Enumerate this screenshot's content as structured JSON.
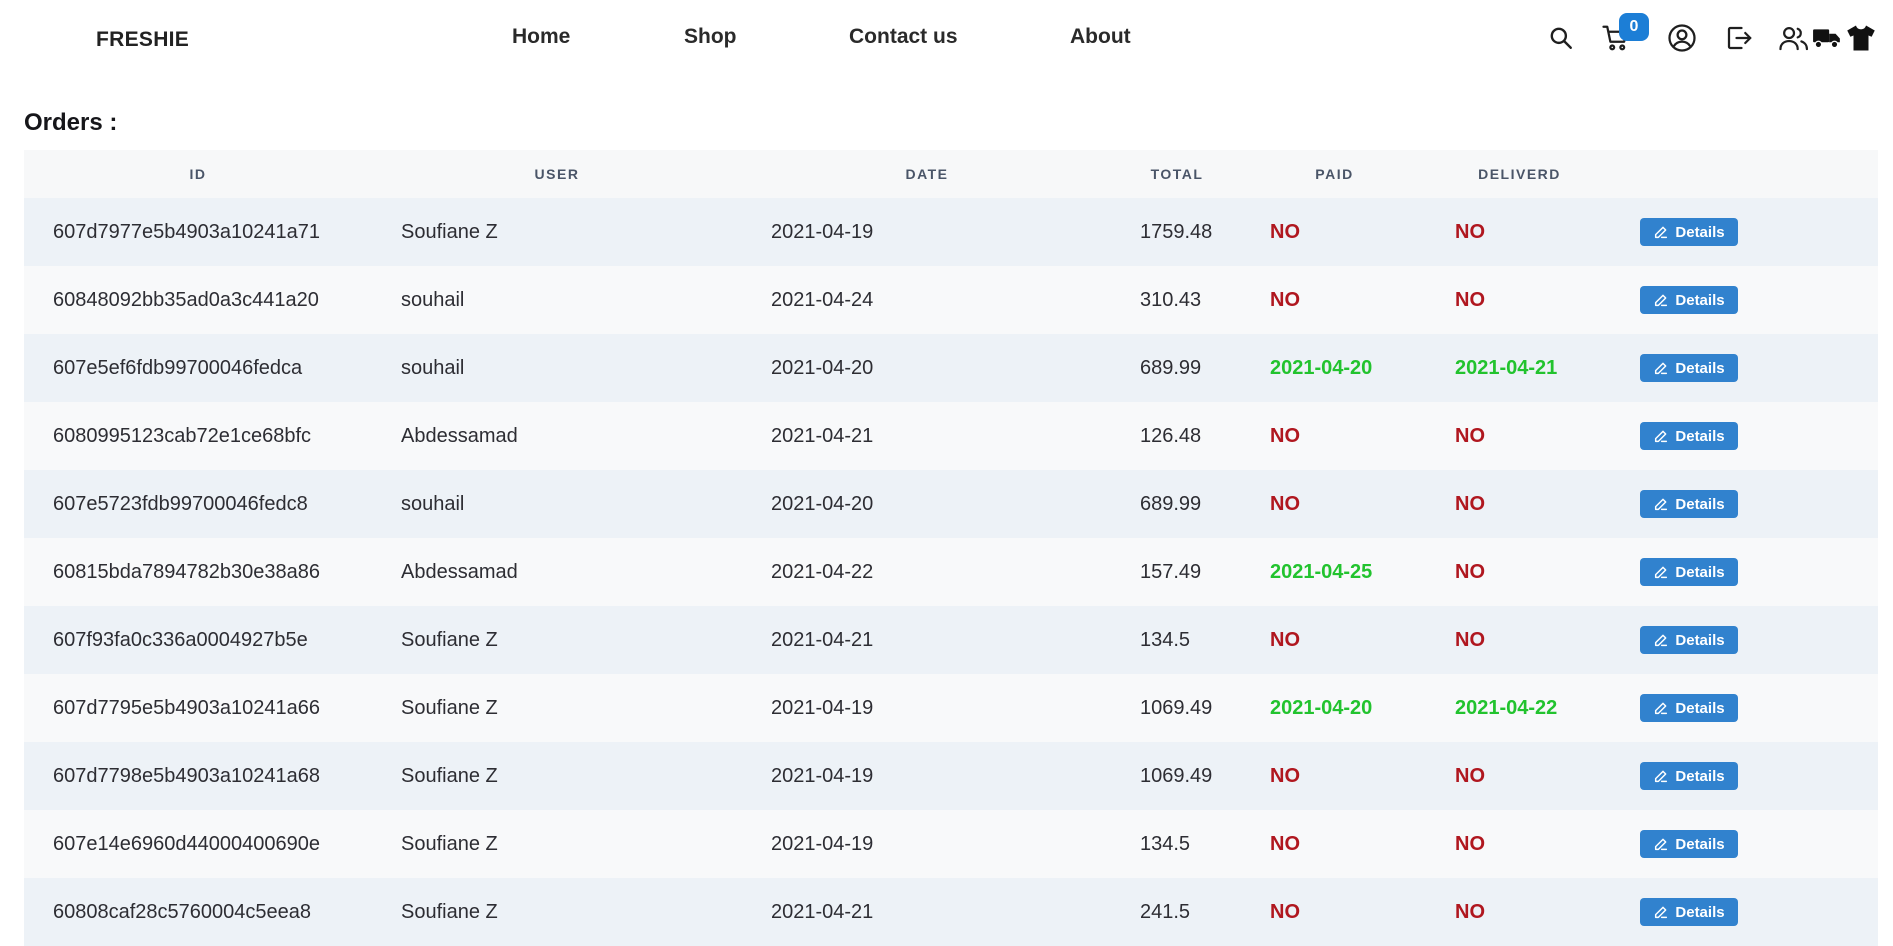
{
  "header": {
    "brand": "FRESHIE",
    "nav": [
      {
        "label": "Home"
      },
      {
        "label": "Shop"
      },
      {
        "label": "Contact us"
      },
      {
        "label": "About"
      }
    ],
    "cart_count": "0",
    "icons": [
      "search-icon",
      "cart-icon",
      "user-circle-icon",
      "logout-icon",
      "users-icon",
      "truck-icon",
      "tshirt-icon"
    ]
  },
  "page_title": "Orders :",
  "table": {
    "columns": [
      "ID",
      "USER",
      "DATE",
      "TOTAL",
      "PAID",
      "DELIVERD"
    ],
    "details_label": "Details",
    "rows": [
      {
        "id": "607d7977e5b4903a10241a71",
        "user": "Soufiane Z",
        "date": "2021-04-19",
        "total": "1759.48",
        "paid": "NO",
        "delivered": "NO"
      },
      {
        "id": "60848092bb35ad0a3c441a20",
        "user": "souhail",
        "date": "2021-04-24",
        "total": "310.43",
        "paid": "NO",
        "delivered": "NO"
      },
      {
        "id": "607e5ef6fdb99700046fedca",
        "user": "souhail",
        "date": "2021-04-20",
        "total": "689.99",
        "paid": "2021-04-20",
        "delivered": "2021-04-21"
      },
      {
        "id": "6080995123cab72e1ce68bfc",
        "user": "Abdessamad",
        "date": "2021-04-21",
        "total": "126.48",
        "paid": "NO",
        "delivered": "NO"
      },
      {
        "id": "607e5723fdb99700046fedc8",
        "user": "souhail",
        "date": "2021-04-20",
        "total": "689.99",
        "paid": "NO",
        "delivered": "NO"
      },
      {
        "id": "60815bda7894782b30e38a86",
        "user": "Abdessamad",
        "date": "2021-04-22",
        "total": "157.49",
        "paid": "2021-04-25",
        "delivered": "NO"
      },
      {
        "id": "607f93fa0c336a0004927b5e",
        "user": "Soufiane Z",
        "date": "2021-04-21",
        "total": "134.5",
        "paid": "NO",
        "delivered": "NO"
      },
      {
        "id": "607d7795e5b4903a10241a66",
        "user": "Soufiane Z",
        "date": "2021-04-19",
        "total": "1069.49",
        "paid": "2021-04-20",
        "delivered": "2021-04-22"
      },
      {
        "id": "607d7798e5b4903a10241a68",
        "user": "Soufiane Z",
        "date": "2021-04-19",
        "total": "1069.49",
        "paid": "NO",
        "delivered": "NO"
      },
      {
        "id": "607e14e6960d44000400690e",
        "user": "Soufiane Z",
        "date": "2021-04-19",
        "total": "134.5",
        "paid": "NO",
        "delivered": "NO"
      },
      {
        "id": "60808caf28c5760004c5eea8",
        "user": "Soufiane Z",
        "date": "2021-04-21",
        "total": "241.5",
        "paid": "NO",
        "delivered": "NO"
      }
    ]
  },
  "colors": {
    "status_no": "#b0171f",
    "status_yes": "#22c32e",
    "button_blue": "#3182ce",
    "badge_blue": "#1c7ed6",
    "row_alt": "#edf2f7",
    "row_plain": "#f8f9fa"
  }
}
